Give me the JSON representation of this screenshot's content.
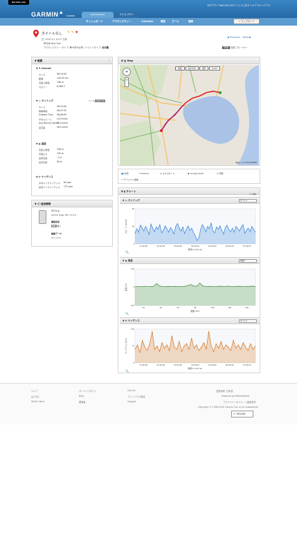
{
  "header": {
    "garmin_tag": "Garmin.com",
    "logo": "GARMIN",
    "logo_sub": "Connect",
    "user_links": "ログアウト  Test1234 ログインしています  ヘルプ  サインアウト",
    "tabs": [
      "myConnect",
      "エクスプロー"
    ],
    "subnav": [
      "ダッシュボード",
      "アクティビティー",
      "Calendar",
      "報告",
      "ゴール",
      "健康"
    ],
    "upload": "アップロード"
  },
  "activity": {
    "title": "タイトルなし",
    "datetime": "日, 2010.5.2 10:17 日本",
    "location": "所在地 New York",
    "types_label": "アクティビティー タイプ",
    "type": "サイクリング",
    "event_label": "イベントタイプ",
    "event": "未分類",
    "prev": "Previous",
    "next": "Next",
    "views": [
      "詳細",
      "分割",
      "プレーヤー"
    ]
  },
  "summary": {
    "title": "概要",
    "overall": {
      "title": "Overall",
      "rows": [
        [
          "タイム",
          "06:14:44"
        ],
        [
          "距離",
          "143.55 km"
        ],
        [
          "高度上昇値",
          "748 m"
        ],
        [
          "カロリー",
          "6,066 C"
        ]
      ]
    },
    "timing": {
      "title": "タイミング",
      "pace_label": "ペース",
      "speed_label": "スピード",
      "rows": [
        [
          "タイム",
          "06:14:44"
        ],
        [
          "移動時間",
          "06:07:55"
        ],
        [
          "Elapsed Time",
          "06:08:09"
        ],
        [
          "平均スピード",
          "23.0 km/h"
        ],
        [
          "Avg Moving Speed",
          "23.4 km/h"
        ],
        [
          "最高速",
          "56.0 km/h"
        ]
      ]
    },
    "elevation": {
      "title": "高度",
      "rows": [
        [
          "高度上昇値",
          "748 m"
        ],
        [
          "高度ロス",
          "743 m"
        ],
        [
          "最低高度",
          "-7 m"
        ],
        [
          "最高高度",
          "60 m"
        ]
      ]
    },
    "cadence": {
      "title": "ケイデンス",
      "rows": [
        [
          "平均バイクケイデンス",
          "64 rpm"
        ],
        [
          "最高バイクケイデンス",
          "170 rpm"
        ]
      ]
    }
  },
  "device": {
    "title": "追加情報",
    "label": "デバイス",
    "name": "Garmin Edge 705, 2.1.0.0",
    "gear_label": "機器変更",
    "gear": "無し",
    "tag": "無料",
    "weather_label": "編集データ",
    "weather": "オリジナル"
  },
  "map": {
    "title": "Map",
    "map_types": [
      "地図",
      "航空写真",
      "地形",
      "Earth"
    ],
    "copyright": "地図データ ©2010 ZENRIN"
  },
  "actions": [
    "共有",
    "Embed",
    "エクスポート",
    "Google Earth",
    "印刷",
    "デバイスへ送信"
  ],
  "chart_data": [
    {
      "type": "area",
      "title": "タイミング",
      "selector": "タイム",
      "ylabel": "スピード (km/h)",
      "xlabel": "時間 (h:mm:ss)",
      "x": [
        "01:00:00",
        "02:00:00",
        "03:00:00",
        "04:00:00",
        "05:00:00",
        "06:00:00",
        "07:00:00"
      ],
      "ylim": [
        0,
        60
      ],
      "values": [
        18,
        26,
        20,
        32,
        28,
        22,
        30,
        24,
        16,
        34,
        27,
        21,
        29,
        25,
        33,
        19,
        23,
        31,
        26,
        20,
        28,
        24,
        17,
        30,
        35,
        27,
        22,
        29,
        18,
        25,
        31,
        23,
        27,
        20,
        14,
        6,
        10,
        24,
        33,
        28,
        21,
        30,
        26,
        36,
        22,
        19,
        29,
        25,
        31,
        23,
        17,
        28,
        32,
        24,
        21,
        27,
        20,
        30,
        26,
        22,
        29,
        33,
        18,
        24,
        27,
        21,
        30,
        25,
        20
      ]
    },
    {
      "type": "area",
      "title": "高度",
      "selector": "距離",
      "ylabel": "高度 (m)",
      "xlabel": "距離 (km)",
      "x": [
        20,
        40,
        60,
        80,
        100,
        120,
        140
      ],
      "ylim": [
        -150,
        150
      ],
      "values": [
        5,
        6,
        4,
        8,
        6,
        5,
        7,
        30,
        9,
        6,
        5,
        7,
        6,
        8,
        5,
        6,
        7,
        12,
        22,
        10,
        8,
        35,
        9,
        6,
        7,
        5,
        6,
        8,
        7,
        6,
        9,
        5,
        6,
        7,
        8,
        6,
        5,
        7,
        9,
        6
      ]
    },
    {
      "type": "area",
      "title": "ケイデンス",
      "selector": "タイム",
      "ylabel": "ケイデンス (rpm)",
      "xlabel": "時間 (h:mm:ss)",
      "x": [
        "01:00:00",
        "02:00:00",
        "03:00:00",
        "04:00:00",
        "05:00:00",
        "06:00:00",
        "07:00:00"
      ],
      "ylim": [
        0,
        150
      ],
      "values": [
        60,
        80,
        45,
        100,
        70,
        55,
        85,
        140,
        60,
        75,
        50,
        90,
        65,
        80,
        55,
        120,
        70,
        60,
        95,
        50,
        75,
        85,
        60,
        110,
        65,
        80,
        55,
        70,
        90,
        60,
        140,
        75,
        50,
        85,
        65,
        95,
        60,
        80,
        70,
        55,
        100,
        65,
        80,
        60,
        90,
        70,
        55,
        85,
        60,
        75
      ]
    }
  ],
  "footer": {
    "col1": [
      "ヘルプ",
      "はじめに",
      "What's New"
    ],
    "col2": [
      "ガーミンコネクト",
      "Blog",
      "開発者"
    ],
    "col3": [
      "Garmin",
      "フィットネス製品",
      "Support"
    ],
    "lang_label": "言語地域:",
    "lang": "日本語",
    "powered": "Powered by MotionBased",
    "privacy": "プライバシーポリシー | 使用条件",
    "copyright": "Copyright © 1996-2010 Garmin Ltd. or its subsidiaries",
    "truste": "TRUSTe"
  },
  "colors": {
    "header": "#1c5d98",
    "timing": "#2f7fd6",
    "elevation": "#3d8a2f",
    "cadence": "#d7731c"
  }
}
